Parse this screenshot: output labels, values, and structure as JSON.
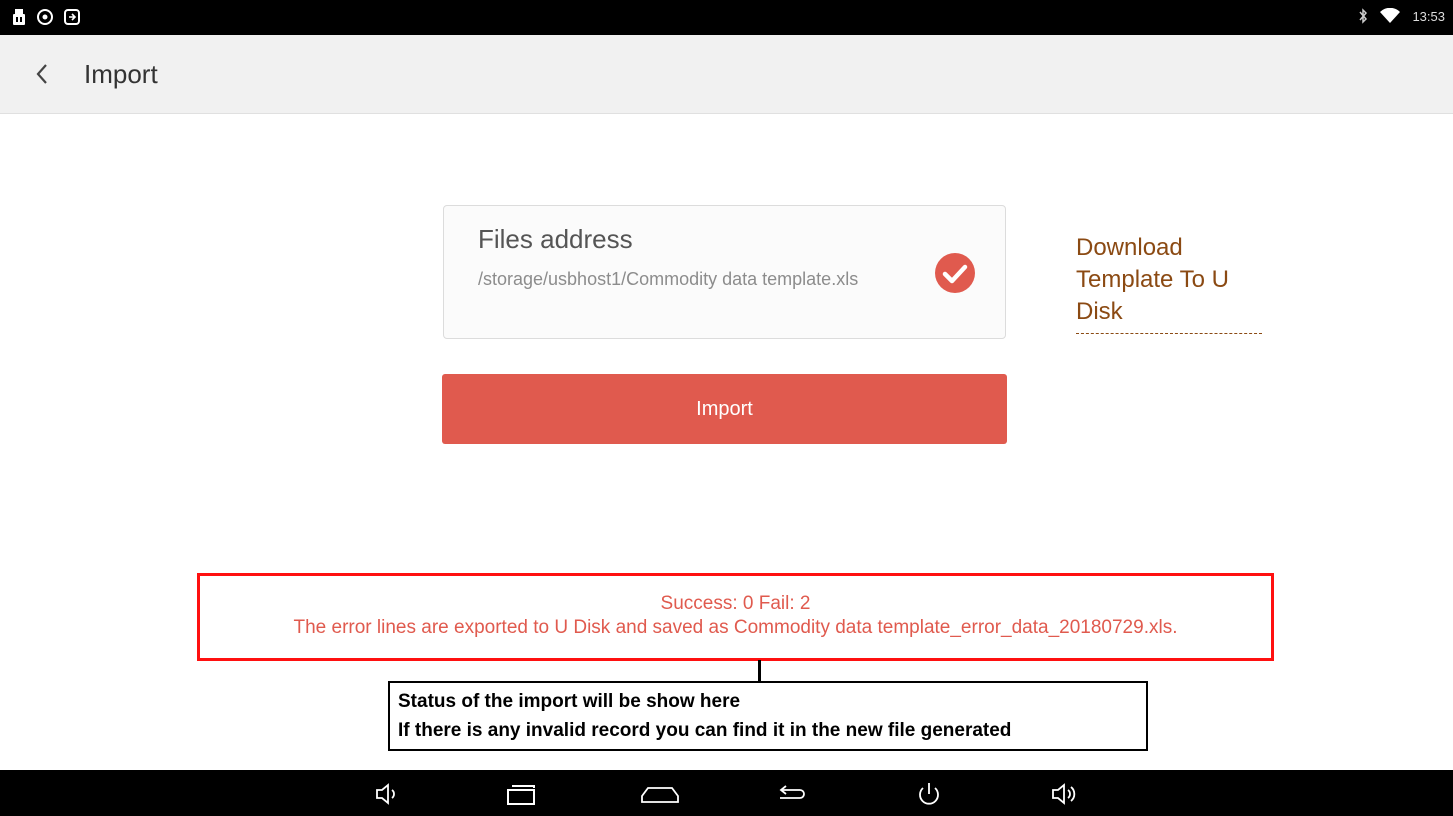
{
  "status_bar": {
    "time": "13:53",
    "left_icons": [
      "usb-icon",
      "eye-icon",
      "screen-share-icon"
    ],
    "right_icons": [
      "bluetooth-icon",
      "wifi-icon"
    ]
  },
  "app_bar": {
    "title": "Import"
  },
  "file_picker": {
    "label": "Files address",
    "path": "/storage/usbhost1/Commodity data template.xls",
    "selected": true
  },
  "download_link": {
    "label": "Download Template To U Disk"
  },
  "import_button": {
    "label": "Import"
  },
  "import_status": {
    "summary": "Success: 0 Fail: 2",
    "detail": "The error lines are exported to U Disk and saved as Commodity data template_error_data_20180729.xls."
  },
  "annotation": {
    "line1": "Status of the import will be show here",
    "line2": "If there is any invalid record you can find it in the new file generated"
  },
  "nav_bar": {
    "buttons": [
      "volume-down-icon",
      "recent-apps-icon",
      "home-icon",
      "back-icon",
      "power-icon",
      "volume-up-icon"
    ]
  },
  "colors": {
    "accent": "#e05a4e",
    "link": "#8b4a13",
    "highlight_border": "#ff1010"
  }
}
